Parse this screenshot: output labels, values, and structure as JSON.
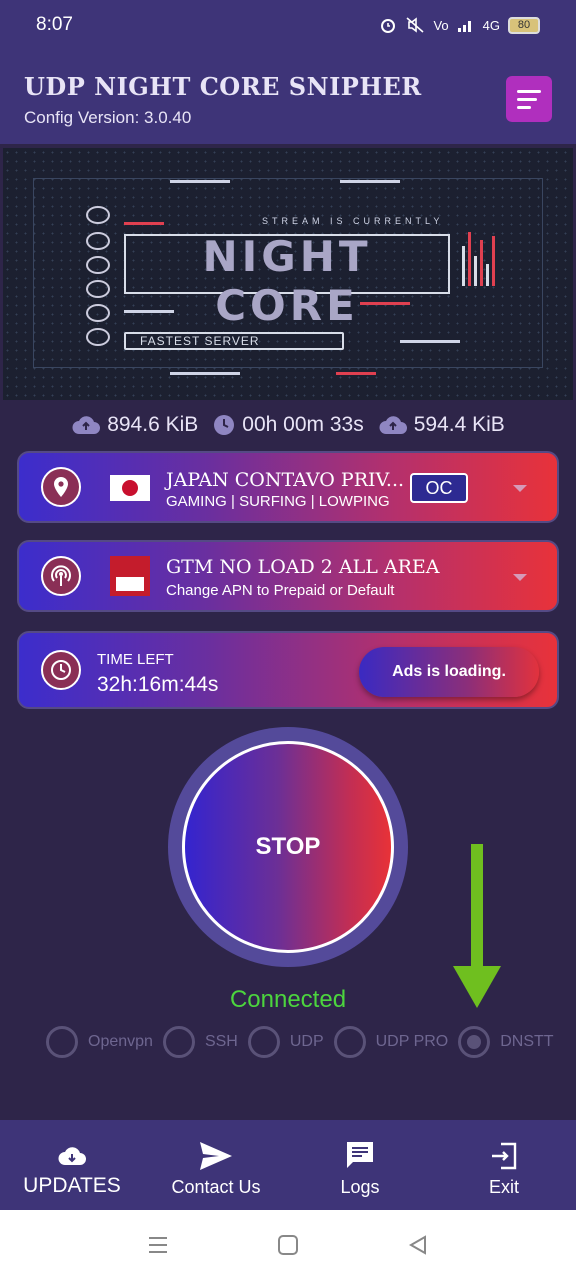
{
  "status_bar": {
    "time": "8:07",
    "network": "4G",
    "battery": "80"
  },
  "app_bar": {
    "title": "UDP NIGHT CORE SNIPHER",
    "config_version": "Config Version: 3.0.40"
  },
  "banner": {
    "logo_text": "NIGHT CORE",
    "top_text": "STREAM IS CURRENTLY",
    "subtitle": "FASTEST SERVER"
  },
  "stats": {
    "upload": "894.6 KiB",
    "duration": "00h 00m 33s",
    "download": "594.4 KiB"
  },
  "server_card": {
    "name": "JAPAN CONTAVO PRIV...",
    "tags": "GAMING | SURFING | LOWPING",
    "badge": "OC"
  },
  "network_card": {
    "name": "GTM NO LOAD 2 ALL AREA",
    "description": "Change APN to Prepaid or Default"
  },
  "time_card": {
    "label": "TIME LEFT",
    "value": "32h:16m:44s",
    "ads_button": "Ads is loading."
  },
  "main_button": {
    "label": "STOP"
  },
  "connection_status": "Connected",
  "modes": [
    {
      "label": "Openvpn",
      "selected": false
    },
    {
      "label": "SSH",
      "selected": false
    },
    {
      "label": "UDP",
      "selected": false
    },
    {
      "label": "UDP PRO",
      "selected": false
    },
    {
      "label": "DNSTT",
      "selected": true
    }
  ],
  "bottom_nav": [
    {
      "label": "UPDATES",
      "icon": "cloud-download-icon"
    },
    {
      "label": "Contact Us",
      "icon": "send-icon"
    },
    {
      "label": "Logs",
      "icon": "chat-icon"
    },
    {
      "label": "Exit",
      "icon": "exit-icon"
    }
  ],
  "colors": {
    "background": "#2e2549",
    "app_bar": "#3e3478",
    "accent_blue": "#3424cf",
    "accent_red": "#e83237",
    "connected": "#4cd53e",
    "menu_button": "#b02fbe",
    "arrow": "#6fbf1f"
  }
}
